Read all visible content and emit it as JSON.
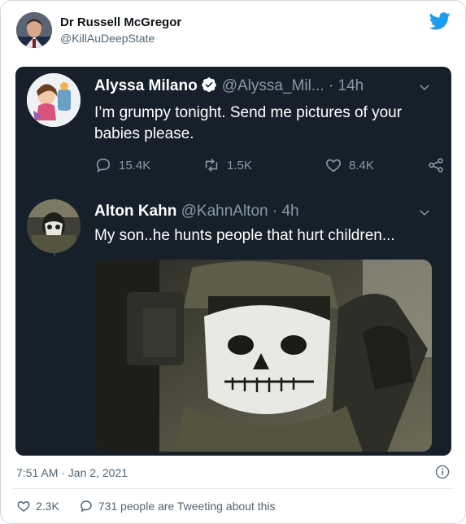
{
  "author": {
    "name": "Dr Russell McGregor",
    "handle": "@KillAuDeepState"
  },
  "quoted_tweet": {
    "name": "Alyssa Milano",
    "handle": "@Alyssa_Mil...",
    "separator": "·",
    "time": "14h",
    "text": "I’m grumpy tonight. Send me pictures of your babies please.",
    "replies": "15.4K",
    "retweets": "1.5K",
    "likes": "8.4K"
  },
  "reply_tweet": {
    "name": "Alton Kahn",
    "handle": "@KahnAlton",
    "separator": "·",
    "time": "4h",
    "text": "My son..he hunts people that hurt children..."
  },
  "meta": {
    "timestamp": "7:51 AM · Jan 2, 2021"
  },
  "footer": {
    "likes": "2.3K",
    "tweeting": "731 people are Tweeting about this"
  },
  "colors": {
    "twitter_blue": "#1d9bf0",
    "dark_bg": "#15202b",
    "muted": "#8899a6"
  },
  "icons": [
    "twitter-bird-icon",
    "verified-badge-icon",
    "chevron-down-icon",
    "reply-icon",
    "retweet-icon",
    "like-icon",
    "share-icon",
    "info-icon"
  ]
}
